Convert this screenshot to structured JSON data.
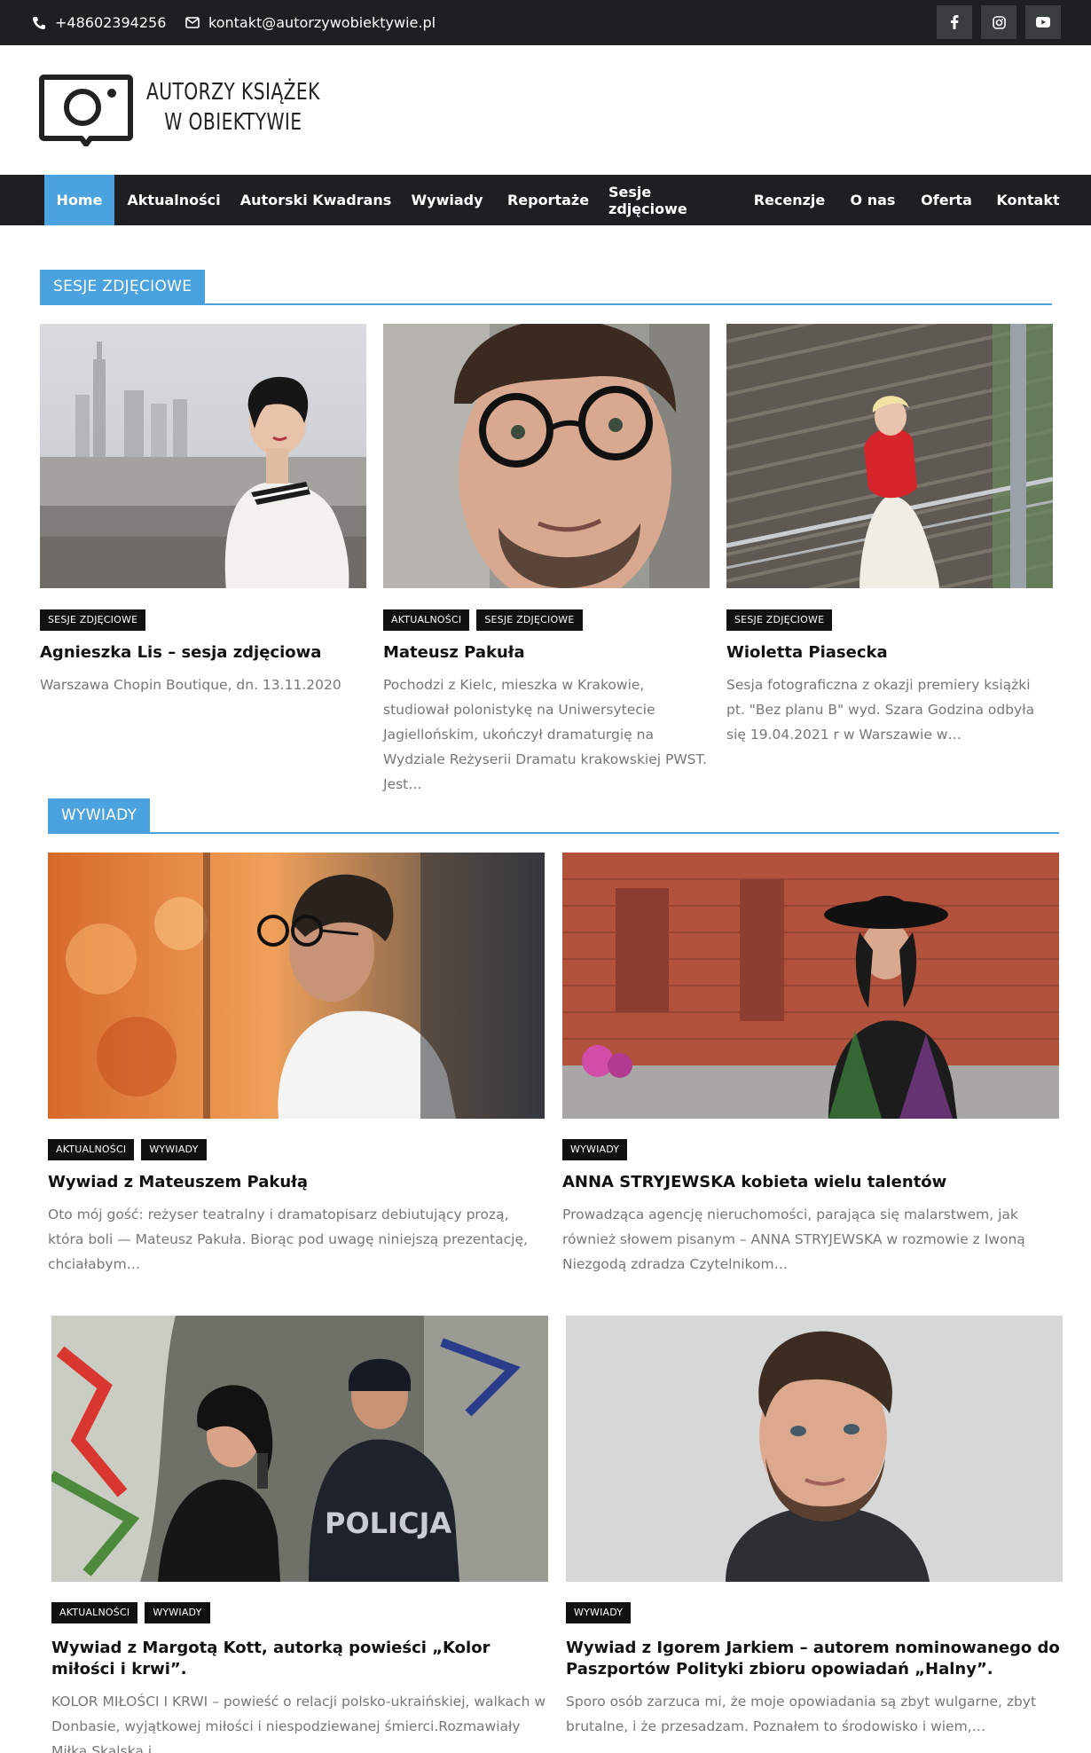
{
  "topbar": {
    "phone": "+48602394256",
    "email": "kontakt@autorzywobiektywie.pl",
    "social": [
      "facebook-icon",
      "instagram-icon",
      "youtube-icon"
    ]
  },
  "logo": {
    "line1": "AUTORZY KSIĄŻEK",
    "line2": "W OBIEKTYWIE"
  },
  "nav": {
    "items": [
      "Home",
      "Aktualności",
      "Autorski Kwadrans",
      "Wywiady",
      "Reportaże",
      "Sesje zdjęciowe",
      "Recenzje",
      "O nas",
      "Oferta",
      "Kontakt"
    ],
    "active": "Home"
  },
  "colors": {
    "accent": "#4aa3df",
    "dark": "#1d1f20",
    "tag": "#111111"
  },
  "sesje": {
    "heading": "SESJE ZDJĘCIOWE",
    "posts": [
      {
        "tags": [
          "SESJE ZDJĘCIOWE"
        ],
        "title": "Agnieszka Lis – sesja zdjęciowa",
        "excerpt": "Warszawa Chopin Boutique, dn. 13.11.2020"
      },
      {
        "tags": [
          "AKTUALNOŚCI",
          "SESJE ZDJĘCIOWE"
        ],
        "title": "Mateusz Pakuła",
        "excerpt": "Pochodzi z Kielc, mieszka w Krakowie, studiował polonistykę na Uniwersytecie Jagiellońskim, ukończył dramaturgię na Wydziale Reżyserii Dramatu krakowskiej PWST. Jest…"
      },
      {
        "tags": [
          "SESJE ZDJĘCIOWE"
        ],
        "title": "Wioletta Piasecka",
        "excerpt": "Sesja fotograficzna z okazji premiery książki pt. \"Bez planu B\" wyd. Szara Godzina odbyła się 19.04.2021 r w Warszawie w…"
      }
    ]
  },
  "wywiady": {
    "heading": "WYWIADY",
    "posts": [
      {
        "tags": [
          "AKTUALNOŚCI",
          "WYWIADY"
        ],
        "title": "Wywiad z Mateuszem Pakułą",
        "excerpt": "Oto mój gość: reżyser teatralny i dramatopisarz debiutujący prozą, która boli — Mateusz Pakuła. Biorąc pod uwagę niniejszą prezentację, chciałabym…"
      },
      {
        "tags": [
          "WYWIADY"
        ],
        "title": "ANNA STRYJEWSKA kobieta wielu talentów",
        "excerpt": "Prowadząca agencję nieruchomości, parająca się malarstwem, jak również słowem pisanym – ANNA STRYJEWSKA w rozmowie z Iwoną Niezgodą zdradza Czytelnikom…"
      },
      {
        "tags": [
          "AKTUALNOŚCI",
          "WYWIADY"
        ],
        "title": "Wywiad z Margotą Kott, autorką powieści „Kolor miłości i krwi”.",
        "excerpt": "KOLOR MIŁOŚCI I KRWI – powieść o relacji polsko-ukraińskiej, walkach w Donbasie, wyjątkowej miłości i niespodziewanej śmierci.Rozmawiały Miłka Skalska i…"
      },
      {
        "tags": [
          "WYWIADY"
        ],
        "title": "Wywiad z Igorem Jarkiem – autorem nominowanego do Paszportów Polityki zbioru opowiadań „Halny”.",
        "excerpt": "Sporo osób zarzuca mi, że moje opowiadania są zbyt wulgarne, zbyt brutalne, i że przesadzam. Poznałem to środowisko i wiem,…"
      }
    ]
  },
  "photo_text": {
    "police": "POLICJA"
  }
}
